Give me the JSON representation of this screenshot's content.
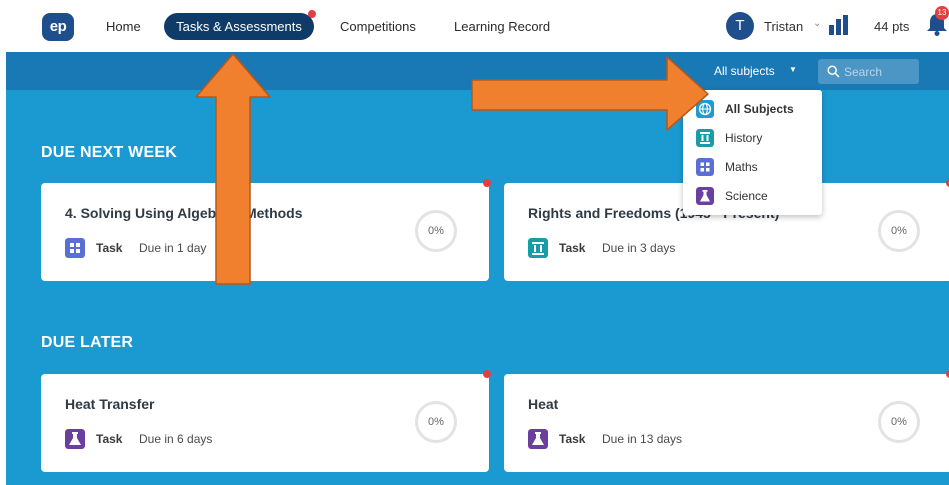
{
  "nav": {
    "logo": "ep",
    "home": "Home",
    "tasks": "Tasks & Assessments",
    "competitions": "Competitions",
    "learning_record": "Learning Record"
  },
  "user": {
    "initial": "T",
    "name": "Tristan",
    "points": "44 pts",
    "notifications": "13"
  },
  "toolbar": {
    "subject_filter": "All subjects",
    "search_placeholder": "Search"
  },
  "sections": {
    "next_week": "DUE NEXT WEEK",
    "later": "DUE LATER"
  },
  "cards": [
    {
      "title": "4. Solving Using Algebraic Methods",
      "type": "Task",
      "due": "Due in 1 day",
      "progress": "0%",
      "subject": "Maths"
    },
    {
      "title": "Rights and Freedoms (1945 - Present)",
      "type": "Task",
      "due": "Due in 3 days",
      "progress": "0%",
      "subject": "History"
    },
    {
      "title": "Heat Transfer",
      "type": "Task",
      "due": "Due in 6 days",
      "progress": "0%",
      "subject": "Science"
    },
    {
      "title": "Heat",
      "type": "Task",
      "due": "Due in 13 days",
      "progress": "0%",
      "subject": "Science"
    }
  ],
  "dropdown": {
    "items": [
      {
        "label": "All Subjects",
        "icon": "globe-icon"
      },
      {
        "label": "History",
        "icon": "pillar-icon"
      },
      {
        "label": "Maths",
        "icon": "calculator-icon"
      },
      {
        "label": "Science",
        "icon": "flask-icon"
      }
    ]
  },
  "colors": {
    "nav_pill": "#0f3b69",
    "content_bg": "#1b9ad1",
    "subbar_bg": "#1979b5",
    "maths": "#5a6fd6",
    "history": "#1a9ba8",
    "science": "#6b3fa0",
    "all_subjects": "#1f9bd1",
    "arrow": "#f07f2e",
    "badge": "#e53e3e"
  }
}
